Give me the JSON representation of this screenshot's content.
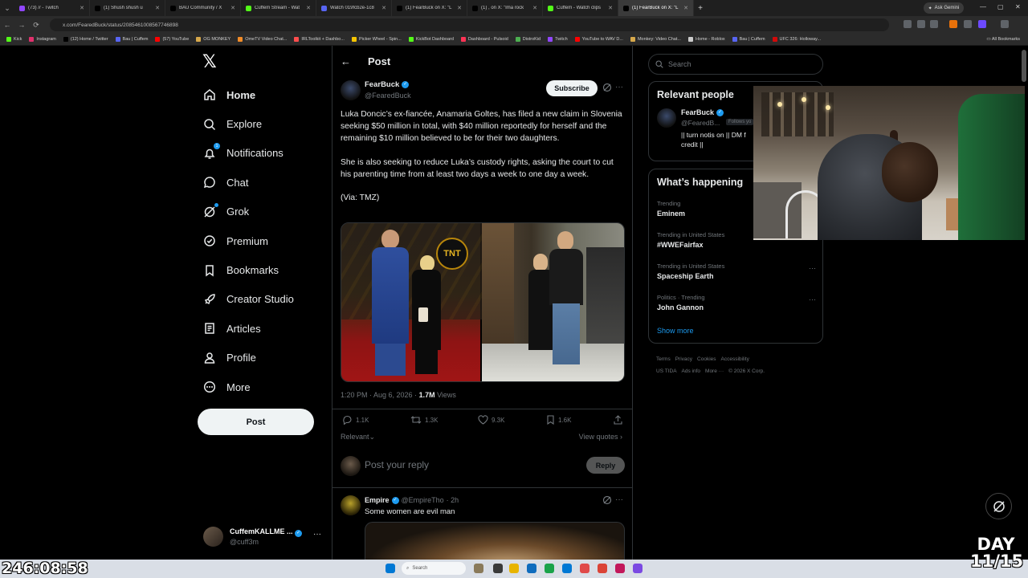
{
  "browser": {
    "tabs": [
      {
        "title": "(73) // - Twitch",
        "color": "#9146ff"
      },
      {
        "title": "(1) Shush shush u",
        "color": "#000000"
      },
      {
        "title": "BAU Community / X",
        "color": "#000000"
      },
      {
        "title": "Cuffem Stream - Wat",
        "color": "#53fc18"
      },
      {
        "title": "Watch 019fcb2e-1c8",
        "color": "#5865f2"
      },
      {
        "title": "(1) FearBuck on X: \"L",
        "color": "#000000"
      },
      {
        "title": "(1) , on X: \"Ima rock",
        "color": "#000000"
      },
      {
        "title": "Cuffem - Watch clips",
        "color": "#53fc18"
      },
      {
        "title": "(1) FearBuck on X: \"L",
        "color": "#000000",
        "active": true
      }
    ],
    "ask_gemini": "Ask Gemini",
    "url": "x.com/FearedBuck/status/2085461008567746898",
    "bookmarks": [
      {
        "label": "Kick",
        "color": "#53fc18"
      },
      {
        "label": "Instagram",
        "color": "#e1306c"
      },
      {
        "label": "(12) Home / Twitter",
        "color": "#000000"
      },
      {
        "label": "Bau | Cuffem",
        "color": "#5865f2"
      },
      {
        "label": "(57) YouTube",
        "color": "#ff0000"
      },
      {
        "label": "OG MONKEY",
        "color": "#d6a84b"
      },
      {
        "label": "OmeTV Video Chat...",
        "color": "#f28c28"
      },
      {
        "label": "IRLToolkit + Dashbo...",
        "color": "#ff4d4d"
      },
      {
        "label": "Picker Wheel - Spin...",
        "color": "#f5c400"
      },
      {
        "label": "KickBot Dashboard",
        "color": "#53fc18"
      },
      {
        "label": "Dashboard - Pulsoid",
        "color": "#ff3355"
      },
      {
        "label": "DistroKid",
        "color": "#4caf50"
      },
      {
        "label": "Twitch",
        "color": "#9146ff"
      },
      {
        "label": "YouTube to WAV D...",
        "color": "#ff0000"
      },
      {
        "label": "Monkey: Video Chat...",
        "color": "#d6a84b"
      },
      {
        "label": "Home - Roblox",
        "color": "#cccccc"
      },
      {
        "label": "Bau | Cuffem",
        "color": "#5865f2"
      },
      {
        "label": "UFC 326: Holloway...",
        "color": "#d20a0a"
      }
    ],
    "all_bookmarks": "All Bookmarks"
  },
  "nav": {
    "items": [
      {
        "label": "Home",
        "icon": "home-icon",
        "bold": true
      },
      {
        "label": "Explore",
        "icon": "search-icon"
      },
      {
        "label": "Notifications",
        "icon": "bell-icon",
        "badge": "1"
      },
      {
        "label": "Chat",
        "icon": "chat-icon"
      },
      {
        "label": "Grok",
        "icon": "grok-icon",
        "dot": true
      },
      {
        "label": "Premium",
        "icon": "premium-icon"
      },
      {
        "label": "Bookmarks",
        "icon": "bookmark-icon"
      },
      {
        "label": "Creator Studio",
        "icon": "rocket-icon"
      },
      {
        "label": "Articles",
        "icon": "articles-icon"
      },
      {
        "label": "Profile",
        "icon": "person-icon"
      },
      {
        "label": "More",
        "icon": "more-circle-icon"
      }
    ],
    "post_button": "Post",
    "account": {
      "name": "CuffemKALLME ...",
      "handle": "@cuff3m"
    }
  },
  "post": {
    "header_title": "Post",
    "author": {
      "name": "FearBuck",
      "handle": "@FearedBuck"
    },
    "subscribe": "Subscribe",
    "paragraphs": [
      "Luka Doncic’s ex-fiancée, Anamaria Goltes, has filed a new claim in Slovenia seeking $50 million in total, with $40 million reportedly for herself and the remaining $10 million believed to be for their two daughters.",
      "She is also seeking to reduce Luka’s custody rights, asking the court to cut his parenting time from at least two days a week to one day a week.",
      "(Via: TMZ)"
    ],
    "timestamp": "1:20 PM · Aug 6, 2026 · ",
    "views_count": "1.7M",
    "views_label": " Views",
    "stats": {
      "replies": "1.1K",
      "reposts": "1.3K",
      "likes": "9.3K",
      "bookmarks": "1.6K"
    },
    "sort_label": "Relevant",
    "view_quotes": "View quotes"
  },
  "reply": {
    "placeholder": "Post your reply",
    "button": "Reply"
  },
  "comment": {
    "name": "Empire",
    "handle": "@EmpireTho",
    "age": "· 2h",
    "text": "Some women are evil man"
  },
  "sidebar": {
    "search_placeholder": "Search",
    "relevant_title": "Relevant people",
    "relevant_person": {
      "name": "FearBuck",
      "handle": "@FearedB...",
      "follows": "Follows yo",
      "bio": "|| turn notis on || DM f credit ||"
    },
    "happening_title": "What’s happening",
    "trends": [
      {
        "context": "Trending",
        "name": "Eminem"
      },
      {
        "context": "Trending in United States",
        "name": "#WWEFairfax"
      },
      {
        "context": "Trending in United States",
        "name": "Spaceship Earth"
      },
      {
        "context": "Politics · Trending",
        "name": "John Gannon"
      }
    ],
    "show_more": "Show more",
    "footer_line1": [
      "Terms",
      "Privacy",
      "Cookies",
      "Accessibility"
    ],
    "footer_line2": [
      "US TIDA",
      "Ads info",
      "More ···",
      "© 2026 X Corp."
    ]
  },
  "stream": {
    "timer": "246:08:58",
    "day": "DAY 11/15"
  },
  "taskbar": {
    "search": "Search"
  }
}
